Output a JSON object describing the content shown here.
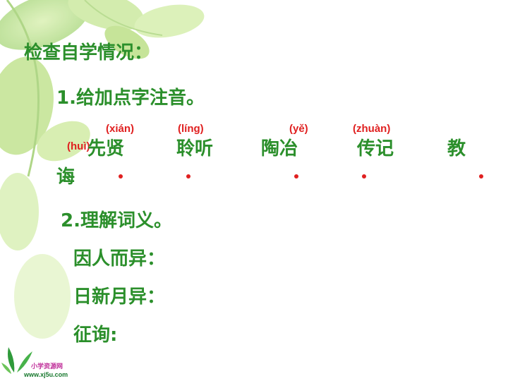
{
  "slide": {
    "heading": "检查自学情况：",
    "q1": {
      "title": "1.给加点字注音。",
      "words": [
        {
          "text": "先贤",
          "pinyin": "(xián)"
        },
        {
          "text": "聆听",
          "pinyin": "(líng)"
        },
        {
          "text": "陶冶",
          "pinyin": "(yě)"
        },
        {
          "text": "传记",
          "pinyin": "(zhuàn)"
        },
        {
          "text": "教",
          "pinyin": ""
        },
        {
          "text": "诲",
          "pinyin": "(huì)"
        }
      ]
    },
    "q2": {
      "title": "2.理解词义。",
      "items": [
        "因人而异：",
        "日新月异：",
        "征询:"
      ]
    }
  },
  "logo": {
    "name": "小学资源网",
    "url": "www.xj5u.com"
  },
  "colors": {
    "text_green": "#2b8f2b",
    "pinyin_red": "#e02020"
  }
}
